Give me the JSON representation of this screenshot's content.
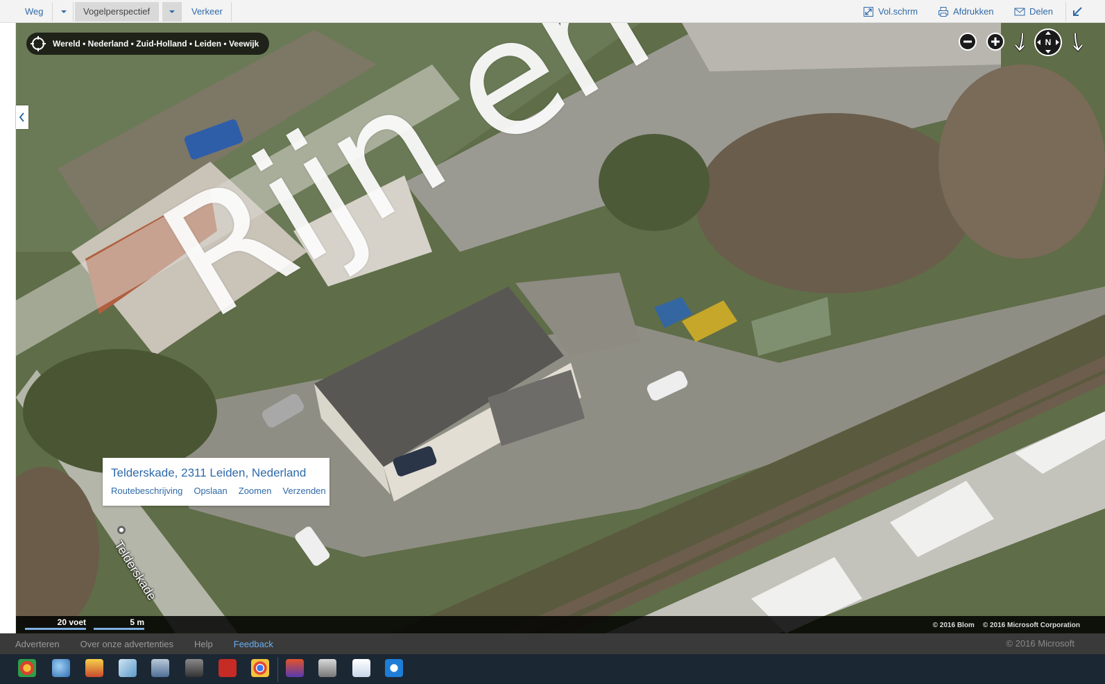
{
  "toolbar": {
    "modes": [
      "Weg",
      "Vogelperspectief",
      "Verkeer"
    ],
    "active_mode": "Vogelperspectief",
    "fullscreen_label": "Vol.schrm",
    "print_label": "Afdrukken",
    "share_label": "Delen"
  },
  "breadcrumb": {
    "path": "Wereld • Nederland • Zuid-Holland • Leiden • Veewijk"
  },
  "map": {
    "overlay_label": "Rijn en Sc",
    "street_label": "Telderskade",
    "compass_label": "N"
  },
  "infobox": {
    "address": "Telderskade, 2311 Leiden, Nederland",
    "actions": [
      "Routebeschrijving",
      "Opslaan",
      "Zoomen",
      "Verzenden"
    ]
  },
  "scale": {
    "imperial": "20 voet",
    "metric": "5 m"
  },
  "attribution": {
    "blom": "© 2016 Blom",
    "microsoft": "© 2016 Microsoft Corporation"
  },
  "footer": {
    "links": [
      "Adverteren",
      "Over onze advertenties",
      "Help",
      "Feedback"
    ],
    "copyright": "© 2016 Microsoft"
  },
  "colors": {
    "link": "#2f6aa8",
    "feedback": "#6aaef0",
    "taskbar": "#1b2733"
  },
  "taskbar_icons": [
    "chrome-like-icon",
    "thunderbird-icon",
    "app-icon",
    "app-icon",
    "app-icon",
    "app-icon",
    "filezilla-icon",
    "chrome-icon",
    "app-icon",
    "app-icon",
    "document-icon",
    "teamviewer-icon"
  ]
}
